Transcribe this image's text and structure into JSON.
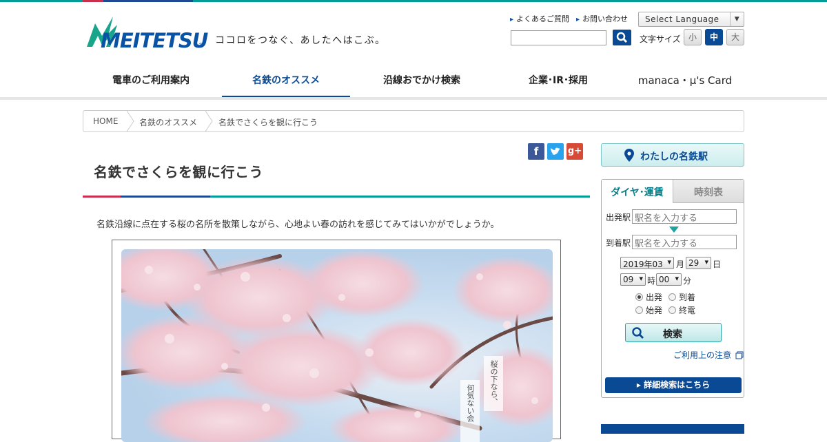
{
  "brand": {
    "logo_text": "MEITETSU",
    "logo_reg": "®",
    "tagline": "ココロをつなぐ、あしたへはこぶ。",
    "colors": {
      "primary": "#0a4a94",
      "teal": "#009c95",
      "red": "#c8304d"
    }
  },
  "header": {
    "util_links": [
      "よくあるご質問",
      "お問い合わせ"
    ],
    "language_select": "Select Language",
    "font_size_label": "文字サイズ",
    "font_sizes": [
      "小",
      "中",
      "大"
    ],
    "font_size_active": "中"
  },
  "nav": {
    "items": [
      "電車のご利用案内",
      "名鉄のオススメ",
      "沿線おでかけ検索",
      "企業･IR･採用",
      "manaca・μ's Card"
    ],
    "active": "名鉄のオススメ"
  },
  "breadcrumb": [
    "HOME",
    "名鉄のオススメ",
    "名鉄でさくらを観に行こう"
  ],
  "main": {
    "title": "名鉄でさくらを観に行こう",
    "share": [
      "f",
      "t",
      "g+"
    ],
    "intro": "名鉄沿線に点在する桜の名所を散策しながら、心地よい春の訪れを感じてみてはいかがでしょうか。",
    "photo_captions": [
      "桜の下なら、",
      "何気ない会"
    ]
  },
  "sidebar": {
    "station_button": "わたしの名鉄駅",
    "tabs": [
      "ダイヤ･運賃",
      "時刻表"
    ],
    "from_label": "出発駅",
    "to_label": "到着駅",
    "station_placeholder": "駅名を入力する",
    "date": {
      "yearmonth": "2019年03",
      "month_unit": "月",
      "day": "29",
      "day_unit": "日"
    },
    "time": {
      "hour": "09",
      "hour_unit": "時",
      "minute": "00",
      "minute_unit": "分"
    },
    "radio_options": [
      "出発",
      "到着",
      "始発",
      "終電"
    ],
    "radio_selected": "出発",
    "search_label": "検索",
    "note": "ご利用上の注意",
    "detail_button": "▸ 詳細検索はこちら"
  }
}
